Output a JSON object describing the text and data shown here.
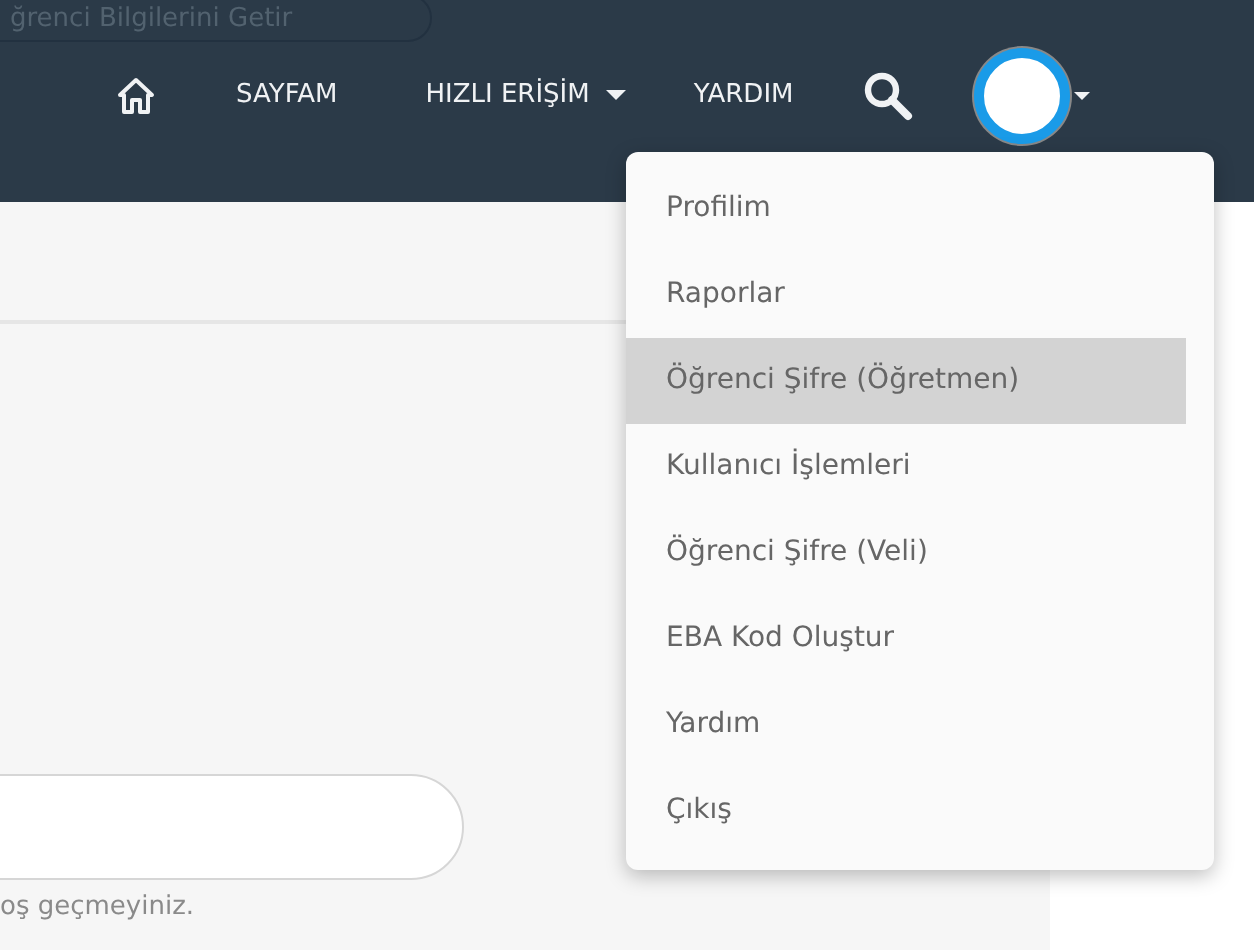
{
  "ghost_button": {
    "label": "ğrenci Bilgilerini Getir"
  },
  "navbar": {
    "items": [
      {
        "kind": "icon"
      },
      {
        "kind": "link",
        "label": "SAYFAM"
      },
      {
        "kind": "dropdown",
        "label": "HIZLI ERİŞİM"
      },
      {
        "kind": "link",
        "label": "YARDIM"
      }
    ]
  },
  "user_menu": {
    "expanded": true,
    "items": [
      {
        "label": "Profilim",
        "selected": false
      },
      {
        "label": "Raporlar",
        "selected": false
      },
      {
        "label": "Öğrenci Şifre (Öğretmen)",
        "selected": true
      },
      {
        "label": "Kullanıcı İşlemleri",
        "selected": false
      },
      {
        "label": "Öğrenci Şifre (Veli)",
        "selected": false
      },
      {
        "label": "EBA Kod Oluştur",
        "selected": false
      },
      {
        "label": "Yardım",
        "selected": false
      },
      {
        "label": "Çıkış",
        "selected": false
      }
    ]
  },
  "form": {
    "help_text": "oş geçmeyiniz."
  }
}
